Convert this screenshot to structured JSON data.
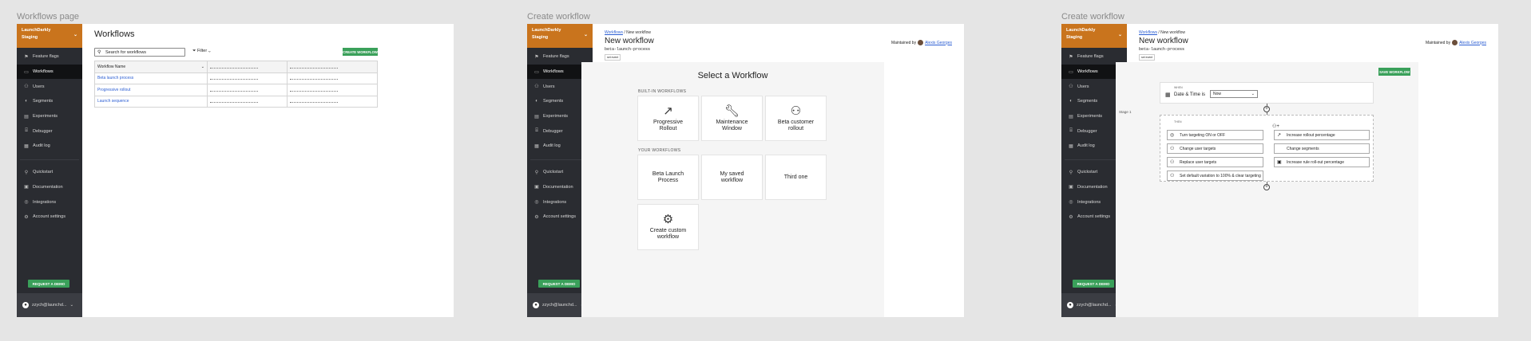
{
  "frames": [
    {
      "title": "Workflows page"
    },
    {
      "title": "Create workflow"
    },
    {
      "title": "Create workflow"
    }
  ],
  "sidebar": {
    "project": "LaunchDarkly",
    "environment": "Staging",
    "nav": [
      {
        "label": "Feature flags",
        "icon": "flag-icon"
      },
      {
        "label": "Workflows",
        "icon": "workflow-icon"
      },
      {
        "label": "Users",
        "icon": "users-icon"
      },
      {
        "label": "Segments",
        "icon": "segments-icon"
      },
      {
        "label": "Experiments",
        "icon": "experiments-icon"
      },
      {
        "label": "Debugger",
        "icon": "debugger-icon"
      },
      {
        "label": "Audit log",
        "icon": "audit-log-icon"
      }
    ],
    "nav2": [
      {
        "label": "Quickstart",
        "icon": "quickstart-icon"
      },
      {
        "label": "Documentation",
        "icon": "documentation-icon"
      },
      {
        "label": "Integrations",
        "icon": "integrations-icon"
      },
      {
        "label": "Account settings",
        "icon": "settings-icon"
      }
    ],
    "demo_button": "REQUEST A DEMO",
    "user": "zzych@launchd..."
  },
  "workflows_page": {
    "title": "Workflows",
    "search_placeholder": "Search for workflows",
    "filter_label": "Filter",
    "create_button": "CREATE WORKFLOW",
    "table": {
      "headers": [
        "Workflow Name"
      ],
      "rows": [
        "Beta launch process",
        "Progressive rollout",
        "Launch sequence"
      ]
    }
  },
  "create_workflow": {
    "breadcrumb_link": "Workflows",
    "breadcrumb_current": "New workflow",
    "title": "New workflow",
    "key": "beta-launch-process",
    "badge": "set event",
    "maintained_by": "Maintained by",
    "maintainer": "Alexis Georges",
    "select_title": "Select a Workflow",
    "builtin_label": "BUILT-IN WORKFLOWS",
    "builtin": [
      {
        "label1": "Progressive",
        "label2": "Rollout",
        "icon": "trending-up-icon"
      },
      {
        "label1": "Maintenance",
        "label2": "Window",
        "icon": "wrench-icon"
      },
      {
        "label1": "Beta customer",
        "label2": "rollout",
        "icon": "users-icon"
      }
    ],
    "your_label": "YOUR WORKFLOWS",
    "yours": [
      {
        "label1": "Beta Launch",
        "label2": "Process"
      },
      {
        "label1": "My saved",
        "label2": "workflow"
      },
      {
        "label1": "Third one",
        "label2": ""
      }
    ],
    "custom": {
      "label1": "Create custom",
      "label2": "workflow",
      "icon": "gear-icon"
    }
  },
  "editor": {
    "save_button": "SAVE WORKFLOW",
    "when_label": "WHEN",
    "date_label": "Date & Time is",
    "date_value": "Now",
    "stage_label": "Stage 1",
    "then_label": "THEN",
    "actions_left": [
      "Turn targeting ON or OFF",
      "Change user targets",
      "Replace user targets",
      "Set default variation to 100% & clear targeting"
    ],
    "actions_right": [
      "Increase rollout percentage",
      "Change segments",
      "Increase rule roll-out percentage"
    ]
  }
}
